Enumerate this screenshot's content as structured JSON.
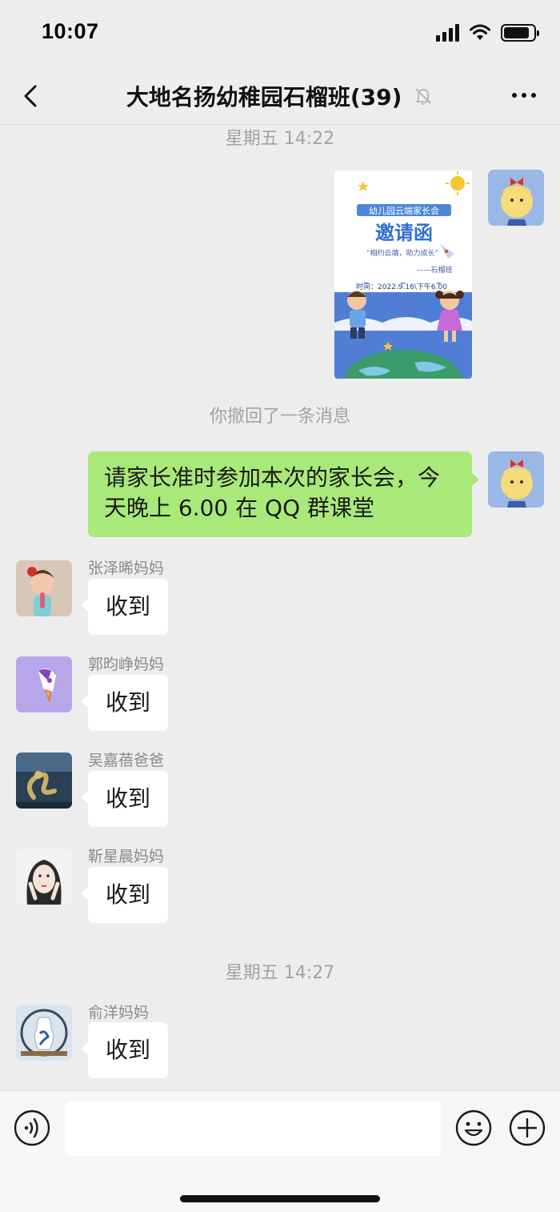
{
  "status_bar": {
    "time": "10:07",
    "battery_level": 0.85
  },
  "nav": {
    "title": "大地名扬幼稚园石榴班",
    "member_count": "(39)",
    "back_icon": "chevron-left-icon",
    "mute_icon": "bell-slash-icon",
    "more_icon": "more-dots-icon"
  },
  "chat": {
    "timestamps": [
      "星期五 14:22",
      "星期五 14:27"
    ],
    "image_message": {
      "banner": "幼儿园云端家长会",
      "headline": "邀请函",
      "slogan": "“相约云端，助力成长”",
      "signature": "——石榴班",
      "time_line": "时间：2022.9.16\\下午6.00"
    },
    "system_message": "你撤回了一条消息",
    "sent_message": "请家长准时参加本次的家长会，今天晚上 6.00 在 QQ 群课堂",
    "replies": [
      {
        "sender": "张泽晞妈妈",
        "text": "收到"
      },
      {
        "sender": "郭昀峥妈妈",
        "text": "收到"
      },
      {
        "sender": "吴嘉蓓爸爸",
        "text": "收到"
      },
      {
        "sender": "靳星晨妈妈",
        "text": "收到"
      },
      {
        "sender": "俞洋妈妈",
        "text": "收到"
      }
    ]
  },
  "input_bar": {
    "placeholder": "",
    "value": ""
  },
  "colors": {
    "background": "#ededed",
    "sent_bubble": "#a9e97a",
    "received_bubble": "#ffffff"
  }
}
